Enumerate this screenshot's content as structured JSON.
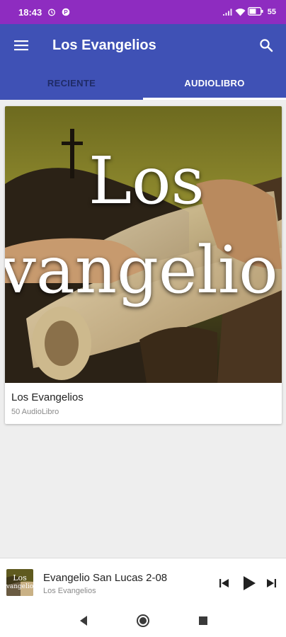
{
  "status_bar": {
    "time": "18:43",
    "battery": "55",
    "colors": {
      "background": "#8e2cc0"
    }
  },
  "app_bar": {
    "title": "Los Evangelios",
    "menu_icon": "hamburger-menu-icon",
    "search_icon": "search-icon",
    "color": "#3f51b5"
  },
  "tabs": [
    {
      "label": "RECIENTE",
      "active": false
    },
    {
      "label": "AUDIOLIBRO",
      "active": true
    }
  ],
  "card": {
    "cover_text_line1": "Los",
    "cover_text_line2": "vangelio",
    "title": "Los Evangelios",
    "subtitle": "50 AudioLibro"
  },
  "player": {
    "title": "Evangelio San Lucas 2-08",
    "subtitle": "Los Evangelios",
    "thumb_text": "Los Evangelios",
    "prev_icon": "skip-previous-icon",
    "play_icon": "play-icon",
    "next_icon": "skip-next-icon"
  },
  "nav_bar": {
    "back_icon": "back-triangle-icon",
    "home_icon": "home-circle-icon",
    "recents_icon": "recents-square-icon"
  }
}
